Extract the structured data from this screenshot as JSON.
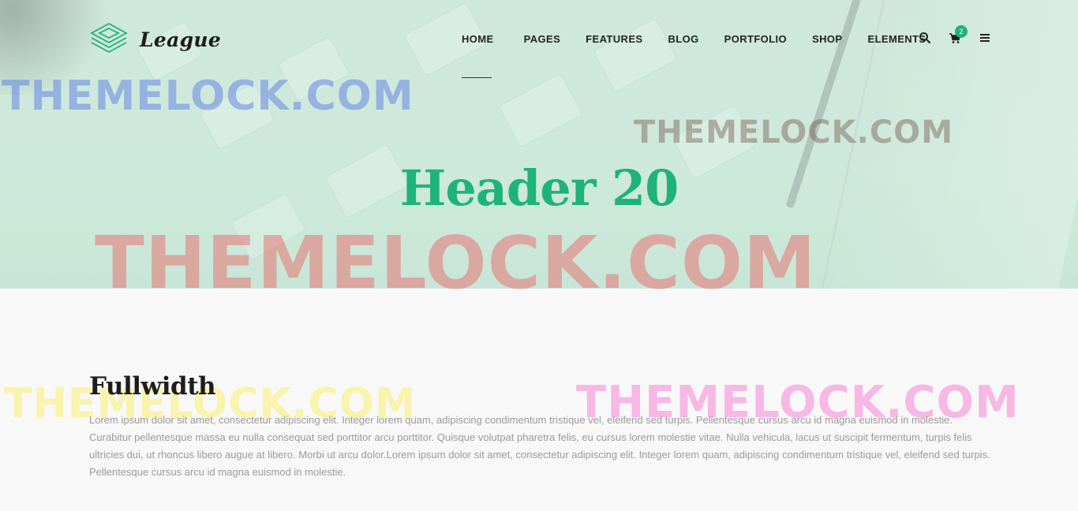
{
  "header": {
    "logo_text": "League",
    "nav": [
      {
        "label": "HOME",
        "active": true
      },
      {
        "label": "PAGES"
      },
      {
        "label": "FEATURES"
      },
      {
        "label": "BLOG"
      },
      {
        "label": "PORTFOLIO"
      },
      {
        "label": "SHOP"
      },
      {
        "label": "ELEMENTS"
      }
    ],
    "icons": [
      "search-icon",
      "cart-icon",
      "menu-icon"
    ],
    "cart_count": "2"
  },
  "hero": {
    "title": "Header 20"
  },
  "watermark": "THEMELOCK.COM",
  "content": {
    "title": "Fullwidth",
    "body": "Lorem ipsum dolor sit amet, consectetur adipiscing elit. Integer lorem quam, adipiscing condimentum tristique vel, eleifend sed turpis. Pellentesque cursus arcu id magna euismod in molestie. Curabitur pellentesque massa eu nulla consequat sed porttitor arcu porttitor. Quisque volutpat pharetra felis, eu cursus lorem molestie vitae. Nulla vehicula, lacus ut suscipit fermentum, turpis felis ultricies dui, ut rhoncus libero augue at libero. Morbi ut arcu dolor.Lorem ipsum dolor sit amet, consectetur adipiscing elit. Integer lorem quam, adipiscing condimentum tristique vel, eleifend sed turpis. Pellentesque cursus arcu id magna euismod in molestie."
  },
  "colors": {
    "accent": "#1fb27b",
    "hero_bg": "#cfe8db",
    "text_dark": "#1d1d1d",
    "text_muted": "#9a9a9a"
  }
}
